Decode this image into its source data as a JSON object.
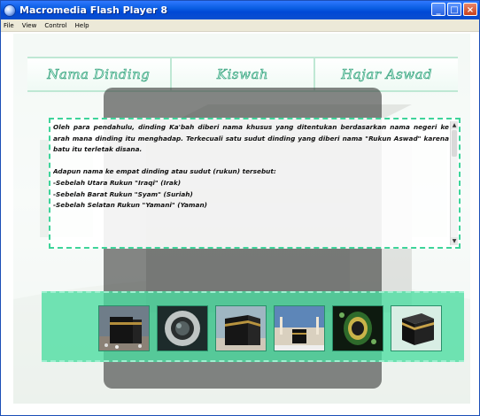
{
  "window": {
    "title": "Macromedia Flash Player 8",
    "minimize_glyph": "_",
    "maximize_glyph": "□",
    "close_glyph": "×"
  },
  "menu": {
    "items": [
      "File",
      "View",
      "Control",
      "Help"
    ]
  },
  "nav": {
    "tabs": [
      {
        "label": "Nama Dinding"
      },
      {
        "label": "Kiswah"
      },
      {
        "label": "Hajar Aswad"
      }
    ]
  },
  "content": {
    "paragraph1": "Oleh para pendahulu, dinding Ka'bah diberi nama khusus yang ditentukan berdasarkan nama negeri ke arah mana dinding itu menghadap. Terkecuali satu sudut dinding yang diberi nama \"Rukun Aswad\" karena batu itu terletak disana.",
    "paragraph2": "Adapun nama ke empat dinding atau sudut (rukun) tersebut:",
    "list": [
      "-Sebelah Utara Rukun \"Iraqi\" (Irak)",
      "-Sebelah Barat Rukun \"Syam\" (Suriah)",
      "-Sebelah Selatan Rukun \"Yamani\" (Yaman)"
    ]
  },
  "scrollbar": {
    "up_glyph": "▲",
    "down_glyph": "▼"
  },
  "thumbnails": [
    {
      "icon": "kaaba-photo-1"
    },
    {
      "icon": "hajar-aswad-photo"
    },
    {
      "icon": "kaaba-photo-2"
    },
    {
      "icon": "masjid-haram-photo"
    },
    {
      "icon": "hajar-aswad-frame-photo"
    },
    {
      "icon": "kaaba-illustration"
    }
  ],
  "colors": {
    "accent_green": "#3ed49a",
    "strip_green": "#4adca0",
    "title_blue": "#0a5ee2"
  }
}
